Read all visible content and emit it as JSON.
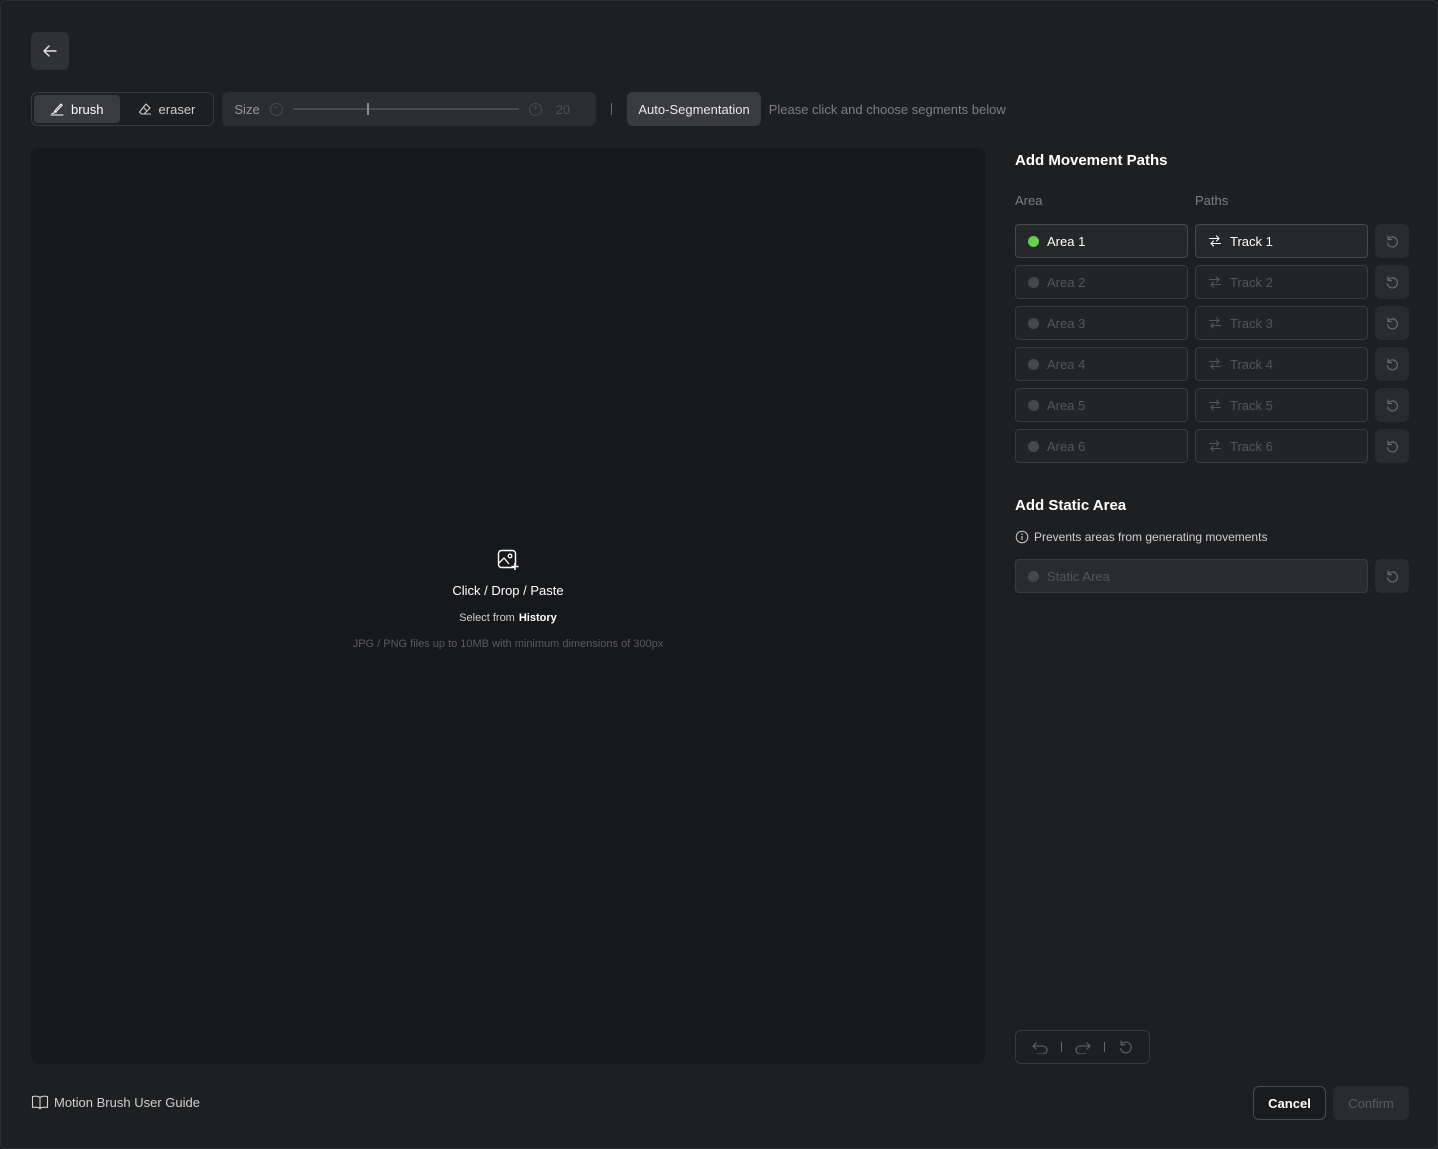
{
  "toolbar": {
    "brush_label": "brush",
    "eraser_label": "eraser",
    "size_label": "Size",
    "size_value": "20",
    "size_fraction": 0.33,
    "auto_segmentation_label": "Auto-Segmentation",
    "hint": "Please click and choose segments below"
  },
  "canvas": {
    "upload_title": "Click / Drop / Paste",
    "select_from": "Select from",
    "history_link": "History",
    "note": "JPG / PNG files up to 10MB with minimum dimensions of 300px"
  },
  "panel": {
    "movement_title": "Add Movement Paths",
    "area_head": "Area",
    "paths_head": "Paths",
    "rows": [
      {
        "area": "Area 1",
        "track": "Track 1",
        "active": true
      },
      {
        "area": "Area 2",
        "track": "Track 2",
        "active": false
      },
      {
        "area": "Area 3",
        "track": "Track 3",
        "active": false
      },
      {
        "area": "Area 4",
        "track": "Track 4",
        "active": false
      },
      {
        "area": "Area 5",
        "track": "Track 5",
        "active": false
      },
      {
        "area": "Area 6",
        "track": "Track 6",
        "active": false
      }
    ],
    "static_title": "Add Static Area",
    "static_info": "Prevents areas from generating movements",
    "static_field": "Static Area"
  },
  "footer": {
    "guide_label": "Motion Brush User Guide",
    "cancel_label": "Cancel",
    "confirm_label": "Confirm"
  },
  "colors": {
    "active_dot": "#5fd44a",
    "background": "#1e1f21",
    "canvas": "#17181a"
  }
}
